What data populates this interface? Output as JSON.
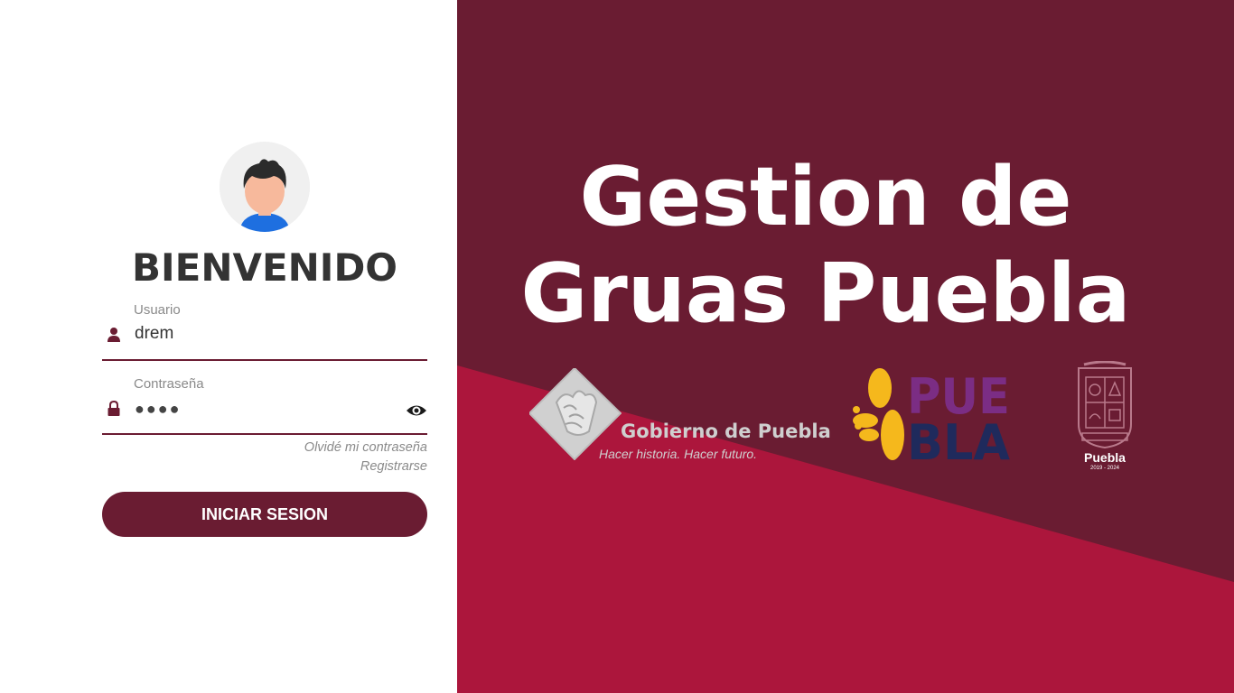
{
  "login": {
    "welcome": "BIENVENIDO",
    "username_label": "Usuario",
    "username_value": "drem",
    "password_label": "Contraseña",
    "password_value": "●●●●",
    "forgot_password": "Olvidé mi contraseña",
    "register": "Registrarse",
    "submit_label": "INICIAR SESION"
  },
  "brand": {
    "title_line1": "Gestion de",
    "title_line2": "Gruas Puebla",
    "gobierno_name": "Gobierno de Puebla",
    "gobierno_slogan": "Hacer historia. Hacer futuro.",
    "puebla_logo_text": "PUEBLA",
    "shield_label": "Puebla",
    "shield_years": "2019 - 2024"
  },
  "colors": {
    "primary": "#6a1c32",
    "accent": "#ac163c",
    "puebla_purple": "#7b2d84",
    "puebla_navy": "#1f2a5c",
    "puebla_yellow": "#f5b81c"
  },
  "icons": {
    "avatar": "user-avatar-icon",
    "username": "user-icon",
    "password": "lock-icon",
    "toggle_password": "eye-icon"
  }
}
